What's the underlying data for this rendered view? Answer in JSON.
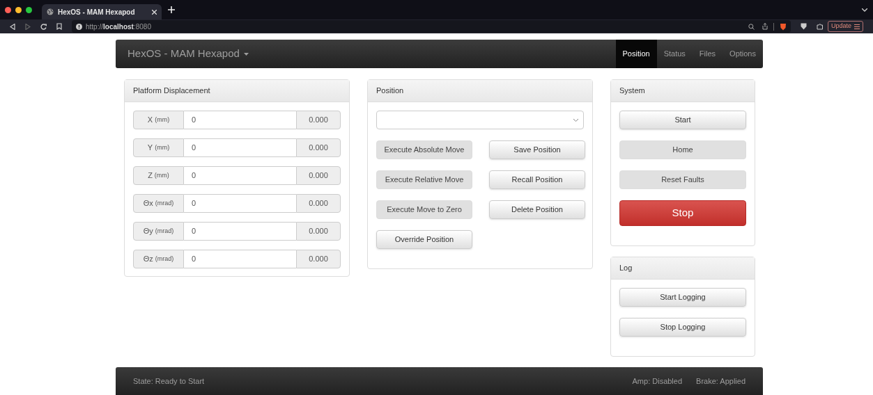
{
  "browser": {
    "tab_title": "HexOS - MAM Hexapod",
    "address": "http://**localhost**:8080",
    "update_button": "Update"
  },
  "navbar": {
    "brand": "HexOS - MAM Hexapod",
    "tabs": [
      {
        "label": "Position",
        "selected": true
      },
      {
        "label": "Status",
        "selected": false
      },
      {
        "label": "Files",
        "selected": false
      },
      {
        "label": "Options",
        "selected": false
      }
    ]
  },
  "displacement": {
    "title": "Platform Displacement",
    "rows": [
      {
        "axis": "X",
        "unit": "(mm)",
        "value": "0",
        "reading": "0.000"
      },
      {
        "axis": "Y",
        "unit": "(mm)",
        "value": "0",
        "reading": "0.000"
      },
      {
        "axis": "Z",
        "unit": "(mm)",
        "value": "0",
        "reading": "0.000"
      },
      {
        "axis": "Θx",
        "unit": "(mrad)",
        "value": "0",
        "reading": "0.000"
      },
      {
        "axis": "Θy",
        "unit": "(mrad)",
        "value": "0",
        "reading": "0.000"
      },
      {
        "axis": "Θz",
        "unit": "(mrad)",
        "value": "0",
        "reading": "0.000"
      }
    ]
  },
  "position": {
    "title": "Position",
    "buttons": [
      {
        "label": "Execute Absolute Move",
        "disabled": true
      },
      {
        "label": "Save Position",
        "disabled": false
      },
      {
        "label": "Execute Relative Move",
        "disabled": true
      },
      {
        "label": "Recall Position",
        "disabled": false
      },
      {
        "label": "Execute Move to Zero",
        "disabled": true
      },
      {
        "label": "Delete Position",
        "disabled": false
      },
      {
        "label": "Override Position",
        "disabled": false
      }
    ]
  },
  "system": {
    "title": "System",
    "buttons": [
      {
        "label": "Start",
        "kind": "default",
        "disabled": false
      },
      {
        "label": "Home",
        "kind": "default",
        "disabled": true
      },
      {
        "label": "Reset Faults",
        "kind": "default",
        "disabled": true
      },
      {
        "label": "Stop",
        "kind": "danger",
        "disabled": false
      }
    ]
  },
  "log": {
    "title": "Log",
    "buttons": [
      {
        "label": "Start Logging",
        "disabled": false
      },
      {
        "label": "Stop Logging",
        "disabled": false
      }
    ]
  },
  "status_bar": {
    "state": "State: Ready to Start",
    "amp": "Amp: Disabled",
    "brake": "Brake: Applied"
  }
}
